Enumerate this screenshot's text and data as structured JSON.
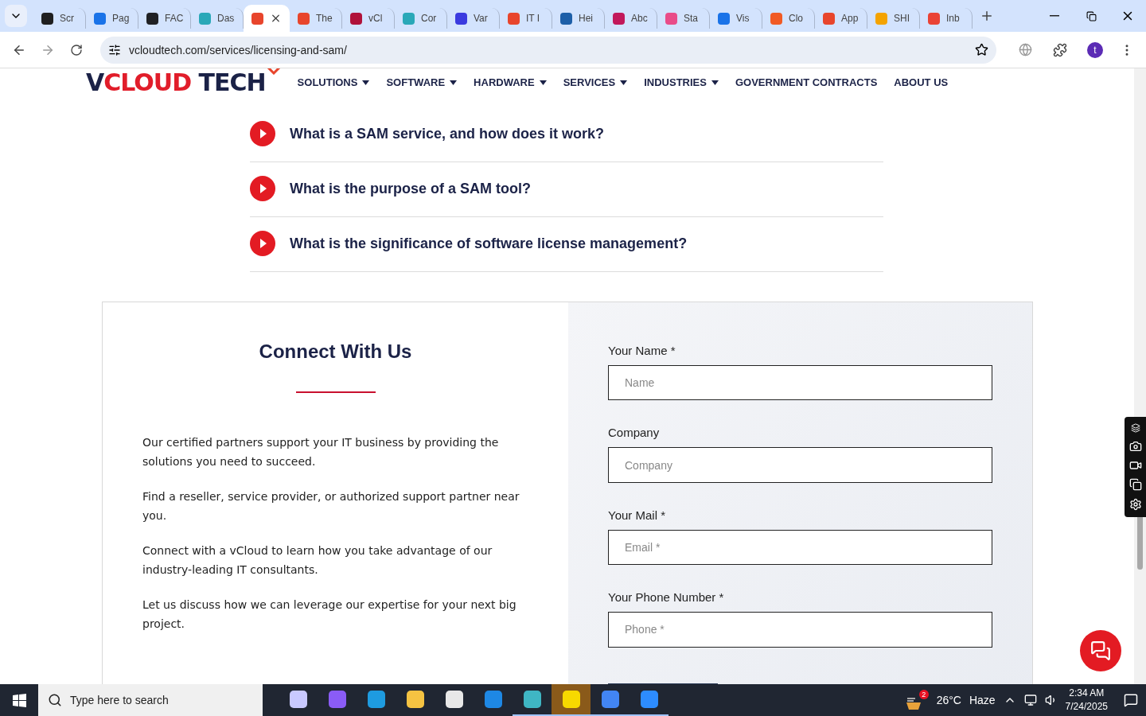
{
  "tabs": [
    {
      "title": "Scr",
      "color": "#1f1f1f",
      "selected": false
    },
    {
      "title": "Pag",
      "color": "#1a73e8",
      "selected": false
    },
    {
      "title": "FAC",
      "color": "#202124",
      "selected": false
    },
    {
      "title": "Das",
      "color": "#2aa8b8",
      "selected": false
    },
    {
      "color": "#e8452c",
      "selected": true
    },
    {
      "title": "The",
      "color": "#e8452c",
      "selected": false
    },
    {
      "title": "vCl",
      "color": "#b0123a",
      "selected": false
    },
    {
      "title": "Cor",
      "color": "#2aa8b8",
      "selected": false
    },
    {
      "title": "Var",
      "color": "#3a3adf",
      "selected": false
    },
    {
      "title": "IT I",
      "color": "#e8452c",
      "selected": false
    },
    {
      "title": "Hei",
      "color": "#1d5fa8",
      "selected": false
    },
    {
      "title": "Abc",
      "color": "#c2185b",
      "selected": false
    },
    {
      "title": "Sta",
      "color": "#e94c89",
      "selected": false
    },
    {
      "title": "Vis",
      "color": "#1a73e8",
      "selected": false
    },
    {
      "title": "Clo",
      "color": "#f15a24",
      "selected": false
    },
    {
      "title": "App",
      "color": "#e8452c",
      "selected": false
    },
    {
      "title": "SHI",
      "color": "#f4a300",
      "selected": false
    },
    {
      "title": "Inb",
      "color": "#ea4335",
      "selected": false
    }
  ],
  "address_bar": {
    "url": "vcloudtech.com/services/licensing-and-sam/"
  },
  "profile": {
    "initial": "t"
  },
  "logo": {
    "parts": [
      {
        "text": "V",
        "color": "#1b2247"
      },
      {
        "text": "CLOUD",
        "color": "#e11d2a"
      },
      {
        "text": " TECH",
        "color": "#1b2247"
      }
    ]
  },
  "nav": [
    {
      "label": "SOLUTIONS",
      "has_dropdown": true
    },
    {
      "label": "SOFTWARE",
      "has_dropdown": true
    },
    {
      "label": "HARDWARE",
      "has_dropdown": true
    },
    {
      "label": "SERVICES",
      "has_dropdown": true
    },
    {
      "label": "INDUSTRIES",
      "has_dropdown": true
    },
    {
      "label": "GOVERNMENT CONTRACTS",
      "has_dropdown": false
    },
    {
      "label": "ABOUT US",
      "has_dropdown": false
    }
  ],
  "faq": [
    {
      "question": "What is a SAM service, and how does it work?"
    },
    {
      "question": "What is the purpose of a SAM tool?"
    },
    {
      "question": "What is the significance of software license management?"
    }
  ],
  "contact": {
    "title": "Connect With Us",
    "paragraphs": [
      "Our certified partners support your IT business by providing the solutions you need to succeed.",
      "Find a reseller, service provider, or authorized support partner near you.",
      "Connect with a vCloud to learn how you take advantage of our industry-leading IT consultants.",
      "Let us discuss how we can leverage our expertise for your next big project."
    ],
    "fields": [
      {
        "label": "Your Name *",
        "placeholder": "Name"
      },
      {
        "label": "Company",
        "placeholder": "Company"
      },
      {
        "label": "Your Mail *",
        "placeholder": "Email *"
      },
      {
        "label": "Your Phone Number *",
        "placeholder": "Phone *"
      }
    ]
  },
  "taskbar": {
    "search_placeholder": "Type here to search",
    "apps": [
      {
        "color": "#c9c9ff",
        "selected": false
      },
      {
        "color": "#8a5cf6",
        "selected": false
      },
      {
        "color": "#1e9be0",
        "selected": false
      },
      {
        "color": "#f5c342",
        "selected": false
      },
      {
        "color": "#e8e8e8",
        "selected": false
      },
      {
        "color": "#1e88e5",
        "selected": false
      },
      {
        "color": "#3fb6c4",
        "selected": true
      },
      {
        "color": "#f7d900",
        "selected": true
      },
      {
        "color": "#4285f4",
        "selected": true
      },
      {
        "color": "#2d8cff",
        "selected": true
      }
    ],
    "weather_badge": "2",
    "temperature": "26°C",
    "condition": "Haze",
    "time": "2:34 AM",
    "date": "7/24/2025"
  }
}
